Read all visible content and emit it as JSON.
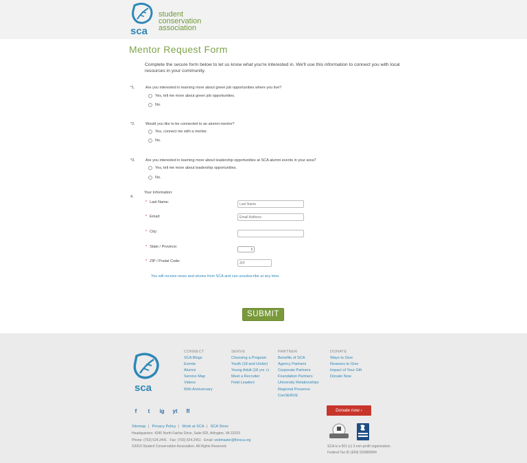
{
  "header": {
    "logo_word": "sca",
    "logo_line1": "student",
    "logo_line2": "conservation",
    "logo_line3": "association"
  },
  "form": {
    "title": "Mentor Request Form",
    "intro": "Complete the secure form below to let us know what you're interested in. We'll use this information to connect you with local resources in your community.",
    "questions": [
      {
        "num": "*1.",
        "text": "Are you interested in learning more about green job opportunities where you live?",
        "options": [
          "Yes, tell me more about green job opportunities.",
          "No."
        ]
      },
      {
        "num": "*2.",
        "text": "Would you like to be connected to an alumni mentor?",
        "options": [
          "Yes, connect me with a mentor.",
          "No."
        ]
      },
      {
        "num": "*3.",
        "text": "Are you interested in learning more about leadership opportunities at SCA alumni events in your area?",
        "options": [
          "Yes, tell me more about leadership opportunities.",
          "No."
        ]
      }
    ],
    "q4_num": "4.",
    "info_label": "Your Information:",
    "fields": {
      "last_name_label": "Last Name:",
      "last_name_placeholder": "Last Name",
      "email_label": "Email:",
      "email_placeholder": "Email Address",
      "city_label": "City:",
      "state_label": "State / Province:",
      "zip_label": "ZIP / Postal Code:",
      "zip_placeholder": "ZIP"
    },
    "required_mark": "*",
    "note": "You will receive news and stories from SCA and can unsubscribe at any time.",
    "submit_label": "SUBMIT"
  },
  "footer": {
    "logo_word": "sca",
    "columns": [
      {
        "head": "CONNECT",
        "links": [
          "SCA Blogs",
          "Events",
          "Alumni",
          "Service Map",
          "Videos",
          "60th Anniversary"
        ]
      },
      {
        "head": "SERVE",
        "links": [
          "Choosing a Program",
          "Youth (18 and Under)",
          "Young Adult (18 yrs +)",
          "Meet a Recruiter",
          "Field Leaders"
        ]
      },
      {
        "head": "PARTNER",
        "links": [
          "Benefits of SCA",
          "Agency Partners",
          "Corporate Partners",
          "Foundation Partners",
          "University Relationships",
          "Regional Presence",
          "ConSERVE"
        ]
      },
      {
        "head": "DONATE",
        "links": [
          "Ways to Give",
          "Reasons to Give",
          "Impact of Your Gift",
          "Donate Now"
        ]
      }
    ],
    "social": [
      "f",
      "t",
      "ig",
      "yt",
      "fl"
    ],
    "donate_label": "Donate now  ›",
    "links": [
      "Sitemap",
      "Privacy Policy",
      "Work at SCA",
      "SCA Store"
    ],
    "address": "Headquarters: 4245 North Fairfax Drive, Suite 825, Arlington, VA 22203",
    "phone": "Phone: (703) 524.2441 · Fax: (703) 524.2451 · Email: ",
    "email": "webmaster@thesca.org",
    "copyright": "©2019 Student Conservation Association. All Rights Reserved.",
    "nonprofit": "SCA is a 501 (c) 3 non-profit organization.",
    "taxid": "Federal Tax ID (EIN) 910880684"
  },
  "colors": {
    "green": "#7ea34a",
    "blue": "#2e87b6",
    "red": "#c7352b"
  }
}
